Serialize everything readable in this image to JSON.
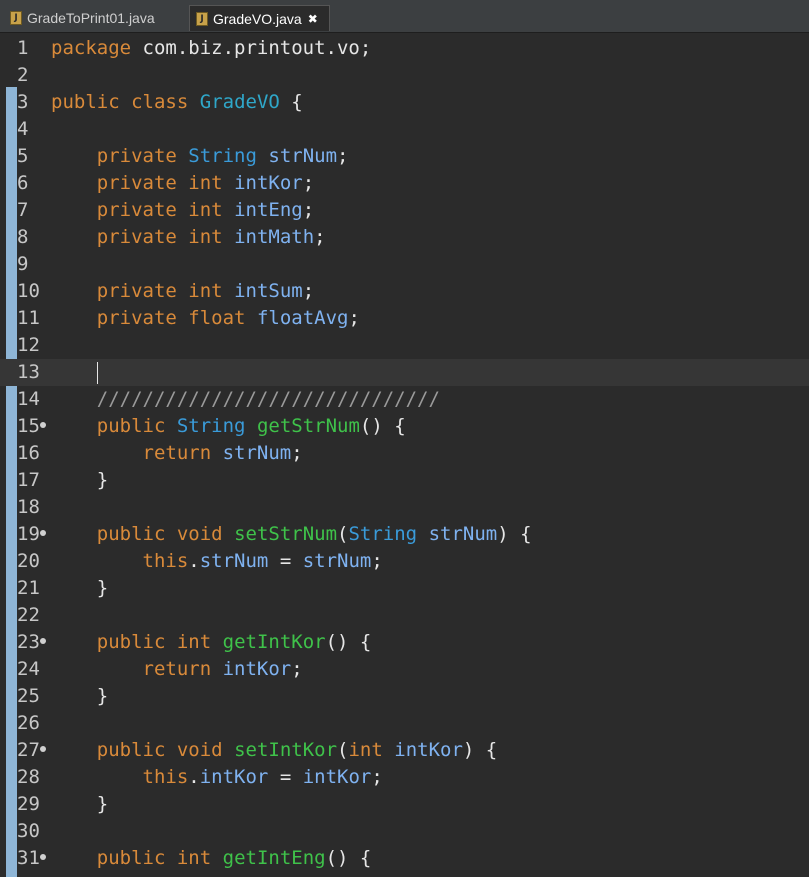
{
  "tabs": [
    {
      "label": "GradeToPrint01.java",
      "active": false
    },
    {
      "label": "GradeVO.java",
      "active": true
    }
  ],
  "close_icon": "✖",
  "file_icon": "J",
  "colors": {
    "keyword": "#d98a3a",
    "type": "#3a9bd9",
    "field": "#7fb2f0",
    "method": "#3fc24a",
    "comment": "#9a9a9a",
    "background": "#2b2b2b"
  },
  "lines": [
    {
      "n": "1",
      "t": [
        [
          "kw",
          "package"
        ],
        [
          "p",
          " com.biz.printout.vo;"
        ]
      ]
    },
    {
      "n": "2",
      "t": []
    },
    {
      "n": "3",
      "t": [
        [
          "kw",
          "public"
        ],
        [
          "p",
          " "
        ],
        [
          "kw",
          "class"
        ],
        [
          "p",
          " "
        ],
        [
          "cls",
          "GradeVO"
        ],
        [
          "p",
          " {"
        ]
      ]
    },
    {
      "n": "4",
      "t": []
    },
    {
      "n": "5",
      "t": [
        [
          "p",
          "    "
        ],
        [
          "kw",
          "private"
        ],
        [
          "p",
          " "
        ],
        [
          "type",
          "String"
        ],
        [
          "p",
          " "
        ],
        [
          "field",
          "strNum"
        ],
        [
          "p",
          ";"
        ]
      ]
    },
    {
      "n": "6",
      "t": [
        [
          "p",
          "    "
        ],
        [
          "kw",
          "private"
        ],
        [
          "p",
          " "
        ],
        [
          "kw",
          "int"
        ],
        [
          "p",
          " "
        ],
        [
          "field",
          "intKor"
        ],
        [
          "p",
          ";"
        ]
      ]
    },
    {
      "n": "7",
      "t": [
        [
          "p",
          "    "
        ],
        [
          "kw",
          "private"
        ],
        [
          "p",
          " "
        ],
        [
          "kw",
          "int"
        ],
        [
          "p",
          " "
        ],
        [
          "field",
          "intEng"
        ],
        [
          "p",
          ";"
        ]
      ]
    },
    {
      "n": "8",
      "t": [
        [
          "p",
          "    "
        ],
        [
          "kw",
          "private"
        ],
        [
          "p",
          " "
        ],
        [
          "kw",
          "int"
        ],
        [
          "p",
          " "
        ],
        [
          "field",
          "intMath"
        ],
        [
          "p",
          ";"
        ]
      ]
    },
    {
      "n": "9",
      "t": []
    },
    {
      "n": "10",
      "t": [
        [
          "p",
          "    "
        ],
        [
          "kw",
          "private"
        ],
        [
          "p",
          " "
        ],
        [
          "kw",
          "int"
        ],
        [
          "p",
          " "
        ],
        [
          "field",
          "intSum"
        ],
        [
          "p",
          ";"
        ]
      ]
    },
    {
      "n": "11",
      "t": [
        [
          "p",
          "    "
        ],
        [
          "kw",
          "private"
        ],
        [
          "p",
          " "
        ],
        [
          "kw",
          "float"
        ],
        [
          "p",
          " "
        ],
        [
          "field",
          "floatAvg"
        ],
        [
          "p",
          ";"
        ]
      ]
    },
    {
      "n": "12",
      "t": []
    },
    {
      "n": "13",
      "t": [
        [
          "p",
          "    "
        ],
        [
          "caret",
          ""
        ]
      ],
      "current": true
    },
    {
      "n": "14",
      "t": [
        [
          "p",
          "    "
        ],
        [
          "cmt",
          "//////////////////////////////"
        ]
      ]
    },
    {
      "n": "15",
      "fold": true,
      "t": [
        [
          "p",
          "    "
        ],
        [
          "kw",
          "public"
        ],
        [
          "p",
          " "
        ],
        [
          "type",
          "String"
        ],
        [
          "p",
          " "
        ],
        [
          "method",
          "getStrNum"
        ],
        [
          "p",
          "() {"
        ]
      ]
    },
    {
      "n": "16",
      "t": [
        [
          "p",
          "        "
        ],
        [
          "kw",
          "return"
        ],
        [
          "p",
          " "
        ],
        [
          "field",
          "strNum"
        ],
        [
          "p",
          ";"
        ]
      ]
    },
    {
      "n": "17",
      "t": [
        [
          "p",
          "    }"
        ]
      ]
    },
    {
      "n": "18",
      "t": []
    },
    {
      "n": "19",
      "fold": true,
      "t": [
        [
          "p",
          "    "
        ],
        [
          "kw",
          "public"
        ],
        [
          "p",
          " "
        ],
        [
          "kw",
          "void"
        ],
        [
          "p",
          " "
        ],
        [
          "method",
          "setStrNum"
        ],
        [
          "p",
          "("
        ],
        [
          "type",
          "String"
        ],
        [
          "p",
          " "
        ],
        [
          "field",
          "strNum"
        ],
        [
          "p",
          ") {"
        ]
      ]
    },
    {
      "n": "20",
      "t": [
        [
          "p",
          "        "
        ],
        [
          "kw",
          "this"
        ],
        [
          "p",
          "."
        ],
        [
          "field",
          "strNum"
        ],
        [
          "p",
          " = "
        ],
        [
          "field",
          "strNum"
        ],
        [
          "p",
          ";"
        ]
      ]
    },
    {
      "n": "21",
      "t": [
        [
          "p",
          "    }"
        ]
      ]
    },
    {
      "n": "22",
      "t": []
    },
    {
      "n": "23",
      "fold": true,
      "t": [
        [
          "p",
          "    "
        ],
        [
          "kw",
          "public"
        ],
        [
          "p",
          " "
        ],
        [
          "kw",
          "int"
        ],
        [
          "p",
          " "
        ],
        [
          "method",
          "getIntKor"
        ],
        [
          "p",
          "() {"
        ]
      ]
    },
    {
      "n": "24",
      "t": [
        [
          "p",
          "        "
        ],
        [
          "kw",
          "return"
        ],
        [
          "p",
          " "
        ],
        [
          "field",
          "intKor"
        ],
        [
          "p",
          ";"
        ]
      ]
    },
    {
      "n": "25",
      "t": [
        [
          "p",
          "    }"
        ]
      ]
    },
    {
      "n": "26",
      "t": []
    },
    {
      "n": "27",
      "fold": true,
      "t": [
        [
          "p",
          "    "
        ],
        [
          "kw",
          "public"
        ],
        [
          "p",
          " "
        ],
        [
          "kw",
          "void"
        ],
        [
          "p",
          " "
        ],
        [
          "method",
          "setIntKor"
        ],
        [
          "p",
          "("
        ],
        [
          "kw",
          "int"
        ],
        [
          "p",
          " "
        ],
        [
          "field",
          "intKor"
        ],
        [
          "p",
          ") {"
        ]
      ]
    },
    {
      "n": "28",
      "t": [
        [
          "p",
          "        "
        ],
        [
          "kw",
          "this"
        ],
        [
          "p",
          "."
        ],
        [
          "field",
          "intKor"
        ],
        [
          "p",
          " = "
        ],
        [
          "field",
          "intKor"
        ],
        [
          "p",
          ";"
        ]
      ]
    },
    {
      "n": "29",
      "t": [
        [
          "p",
          "    }"
        ]
      ]
    },
    {
      "n": "30",
      "t": []
    },
    {
      "n": "31",
      "fold": true,
      "t": [
        [
          "p",
          "    "
        ],
        [
          "kw",
          "public"
        ],
        [
          "p",
          " "
        ],
        [
          "kw",
          "int"
        ],
        [
          "p",
          " "
        ],
        [
          "method",
          "getIntEng"
        ],
        [
          "p",
          "() {"
        ]
      ]
    }
  ]
}
